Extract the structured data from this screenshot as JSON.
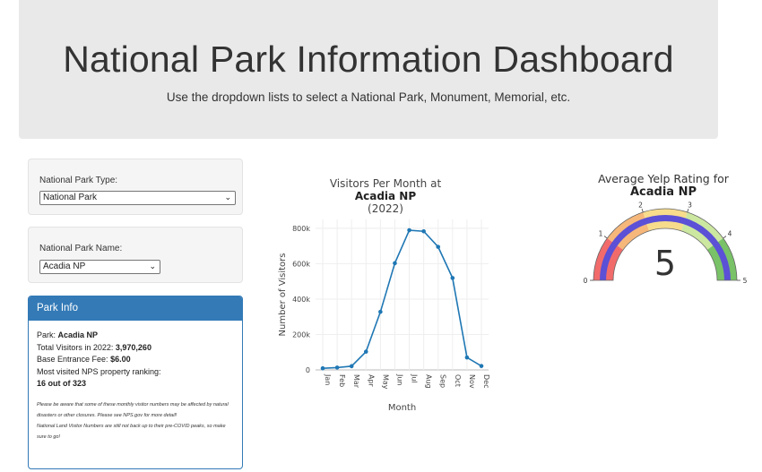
{
  "header": {
    "title": "National Park Information Dashboard",
    "subtitle": "Use the dropdown lists to select a National Park, Monument, Memorial, etc."
  },
  "filters": {
    "type_label": "National Park Type:",
    "type_value": "National Park",
    "name_label": "National Park Name:",
    "name_value": "Acadia NP"
  },
  "park_info": {
    "heading": "Park Info",
    "park_label": "Park:",
    "park_value": "Acadia NP",
    "visitors_label": "Total Visitors in 2022:",
    "visitors_value": "3,970,260",
    "fee_label": "Base Entrance Fee:",
    "fee_value": "$6.00",
    "ranking_label": "Most visited NPS property ranking:",
    "ranking_value": "16 out of 323",
    "note1": "Please be aware that some of these monthly visitor numbers may be affected by natural disasters or other closures. Please see NPS.gov for more detail!",
    "note2": "National Land Visitor Numbers are still not back up to their pre-COVID peaks, so make sure to go!"
  },
  "chart_data": [
    {
      "type": "line",
      "title_line1": "Visitors Per Month at",
      "title_line2": "Acadia NP",
      "title_line3": "(2022)",
      "xlabel": "Month",
      "ylabel": "Number of Visitors",
      "categories": [
        "Jan",
        "Feb",
        "Mar",
        "Apr",
        "May",
        "Jun",
        "Jul",
        "Aug",
        "Sep",
        "Oct",
        "Nov",
        "Dec"
      ],
      "values": [
        9000,
        13000,
        21000,
        103000,
        328000,
        603000,
        789000,
        783000,
        695000,
        519000,
        70000,
        22000
      ],
      "yticks": [
        0,
        200000,
        400000,
        600000,
        800000
      ],
      "ytick_labels": [
        "0",
        "200k",
        "400k",
        "600k",
        "800k"
      ],
      "ylim": [
        0,
        850000
      ],
      "grid": true,
      "line_color": "#1f77b4"
    },
    {
      "type": "gauge",
      "title_line1": "Average Yelp Rating for",
      "title_line2": "Acadia NP",
      "value": 5,
      "value_label": "5",
      "range": [
        0,
        5
      ],
      "tick_labels": [
        "0",
        "1",
        "2",
        "3",
        "4",
        "5"
      ],
      "bands": [
        {
          "from": 0,
          "to": 1,
          "color": "#f26b6b"
        },
        {
          "from": 1,
          "to": 2,
          "color": "#f6b77a"
        },
        {
          "from": 2,
          "to": 3,
          "color": "#f7dc8c"
        },
        {
          "from": 3,
          "to": 4,
          "color": "#cce7a0"
        },
        {
          "from": 4,
          "to": 5,
          "color": "#79c267"
        }
      ],
      "bar_color": "#5b50d6"
    }
  ]
}
